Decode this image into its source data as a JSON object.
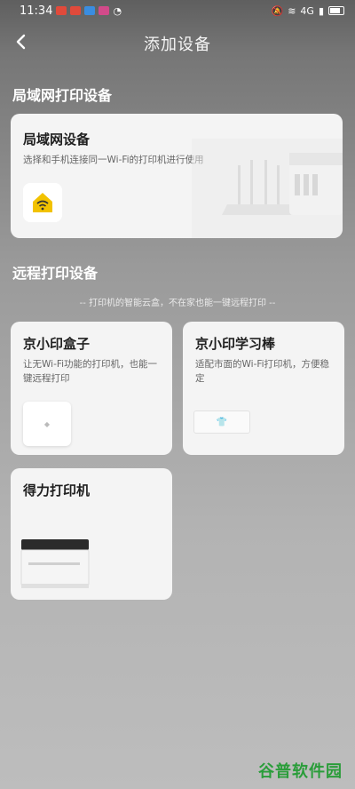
{
  "status": {
    "time": "11:34",
    "network": "4G"
  },
  "header": {
    "title": "添加设备"
  },
  "lan_section": {
    "title": "局域网打印设备",
    "card": {
      "title": "局域网设备",
      "desc": "选择和手机连接同一Wi-Fi的打印机进行使用"
    }
  },
  "remote_section": {
    "title": "远程打印设备",
    "hint": "-- 打印机的智能云盒，不在家也能一键远程打印 --",
    "cards": [
      {
        "title": "京小印盒子",
        "desc": "让无Wi-Fi功能的打印机，也能一键远程打印"
      },
      {
        "title": "京小印学习棒",
        "desc": "适配市面的Wi-Fi打印机，方便稳定"
      },
      {
        "title": "得力打印机",
        "desc": ""
      }
    ]
  },
  "watermark": "谷普软件园",
  "colors": {
    "wifi_icon": "#f2c200",
    "watermark": "#2a9d3a"
  }
}
